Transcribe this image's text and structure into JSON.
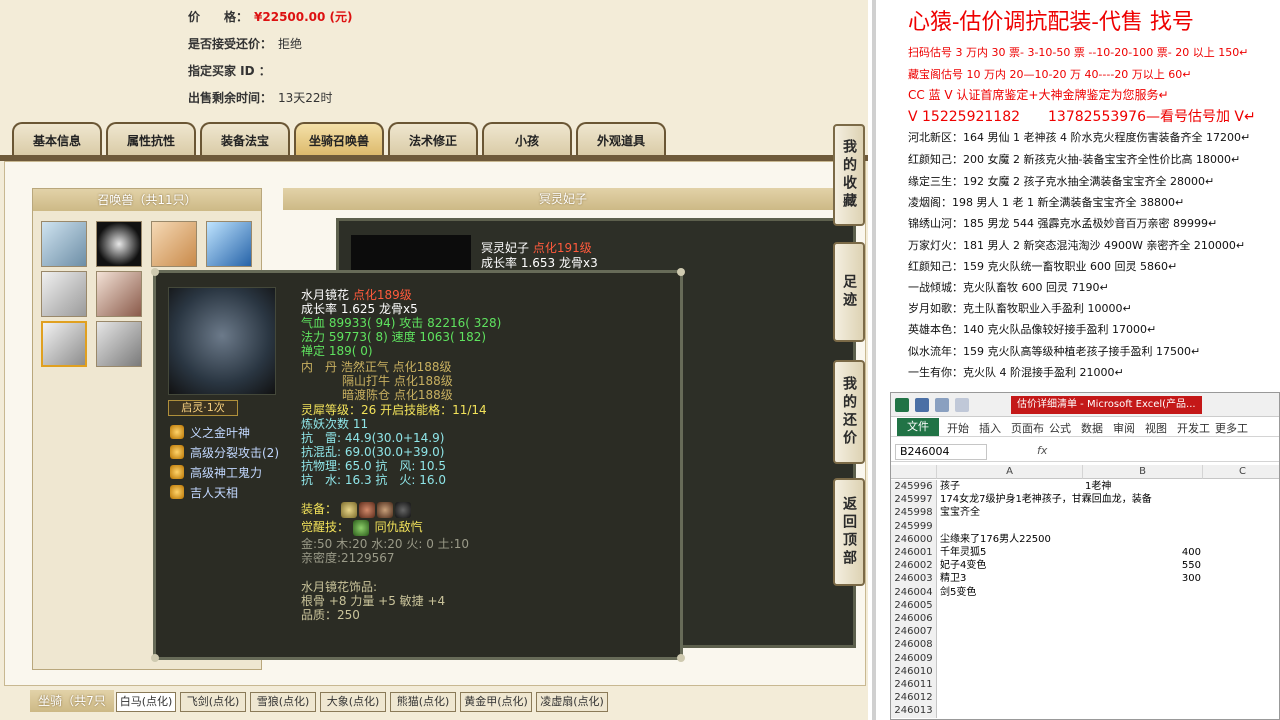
{
  "listing": {
    "price_label": "价　　格：",
    "price_value": "¥22500.00 (元)",
    "counter_offer_label": "是否接受还价：",
    "counter_offer_value": "拒绝",
    "buyer_label": "指定买家 ID ：",
    "buyer_value": "",
    "time_left_label": "出售剩余时间：",
    "time_left_value": "13天22时"
  },
  "tabs": [
    "基本信息",
    "属性抗性",
    "装备法宝",
    "坐骑召唤兽",
    "法术修正",
    "小孩",
    "外观道具"
  ],
  "side_buttons": [
    "我的收藏",
    "足迹",
    "我的还价",
    "返回顶部"
  ],
  "pet_panel": {
    "title": "召唤兽（共11只）"
  },
  "detail_title": "冥灵妃子",
  "bg_pet": {
    "name": "冥灵妃子",
    "level": "点化191级",
    "growth": "成长率 1.653 龙骨x3"
  },
  "tooltip": {
    "name": "水月镜花",
    "level": "点化189级",
    "growth": "成长率 1.625 龙骨x5",
    "hp": "气血 89933( 94) 攻击 82216( 328)",
    "mp": "法力 59773( 8) 速度 1063( 182)",
    "zen": "禅定 189( 0)",
    "neidan1": "内　丹 浩然正气 点化188级",
    "neidan2": "隔山打牛 点化188级",
    "neidan3": "暗渡陈仓 点化188级",
    "soul": "灵犀等级：26 开启技能格：11/14",
    "refine": "炼妖次数 11",
    "res1": "抗　雷: 44.9(30.0+14.9)",
    "res2": "抗混乱: 69.0(30.0+39.0)",
    "res3": "抗物理: 65.0 抗　风: 10.5",
    "res4": "抗　水: 16.3 抗　火: 16.0",
    "equip_label": "装备：",
    "awaken_label": "觉醒技：",
    "awaken_value": "同仇敌忾",
    "elements": "金:50 木:20 水:20 火: 0 土:10",
    "intimacy": "亲密度:2129567",
    "ornament_title": "水月镜花饰品:",
    "ornament_stats": "根骨 +8 力量 +5 敏捷 +4",
    "ornament_quality": "品质：250",
    "spirit_badge": "启灵·1次",
    "skills": [
      "义之金叶神",
      "高级分裂攻击(2)",
      "高级神工鬼力",
      "吉人天相"
    ]
  },
  "bottom": {
    "title": "坐骑（共7只",
    "tabs": [
      "白马(点化)",
      "飞剑(点化)",
      "雪狼(点化)",
      "大象(点化)",
      "熊猫(点化)",
      "黄金甲(点化)",
      "凌虚扇(点化)"
    ]
  },
  "notes": {
    "title": "心猿-估价调抗配装-代售 找号",
    "red_lines": [
      "扫码估号 3 万内 30 票- 3-10-50 票 --10-20-100 票- 20 以上 150↵",
      "藏宝阁估号 10 万内 20—10-20 万 40----20 万以上 60↵",
      "CC 蓝 V 认证首席鉴定+大神金牌鉴定为您服务↵",
      "V 15225921182　　13782553976—看号估号加 V↵"
    ],
    "lines": [
      "河北新区：164 男仙 1 老神孩 4 阶水克火程度伤害装备齐全 17200↵",
      "红颜知己：200 女魔 2 新孩克火抽-装备宝宝齐全性价比高 18000↵",
      "缘定三生：192 女魔 2 孩子克水抽全满装备宝宝齐全 28000↵",
      "凌烟阁：198 男人 1 老 1 新全满装备宝宝齐全 38800↵",
      "锦绣山河：185 男龙 544 强霹克水孟极妙音百万亲密 89999↵",
      "万家灯火：181 男人 2 新突态混沌淘沙 4900W 亲密齐全 210000↵",
      "红颜知己：159 克火队统一畜牧职业 600 回灵 5860↵",
      "一战倾城：克火队畜牧 600 回灵 7190↵",
      "岁月如歌：克土队畜牧职业入手盈利 10000↵",
      "英雄本色：140 克火队品像较好接手盈利 17000↵",
      "似水流年：159 克火队高等级种植老孩子接手盈利 17500↵",
      "一生有你：克火队 4 阶混接手盈利 21000↵"
    ]
  },
  "excel": {
    "title": "估价详细清单 - Microsoft Excel(产品...",
    "menu": [
      "文件",
      "开始",
      "插入",
      "页面布",
      "公式",
      "数据",
      "审阅",
      "视图",
      "开发工",
      "更多工"
    ],
    "namebox": "B246004",
    "fx": "fx",
    "col_headers": [
      "A",
      "B",
      "C"
    ],
    "rows": [
      {
        "n": "245996",
        "a": "孩子",
        "b": "1老神"
      },
      {
        "n": "245997",
        "a": "174女龙7级护身1老神孩子，甘霖回血龙，装备",
        "b": ""
      },
      {
        "n": "245998",
        "a": "宝宝齐全",
        "b": ""
      },
      {
        "n": "245999",
        "a": "",
        "b": ""
      },
      {
        "n": "246000",
        "a": "尘缘来了176男人22500",
        "b": ""
      },
      {
        "n": "246001",
        "a": "千年灵狐5",
        "b": "400"
      },
      {
        "n": "246002",
        "a": "妃子4变色",
        "b": "550"
      },
      {
        "n": "246003",
        "a": "精卫3",
        "b": "300"
      },
      {
        "n": "246004",
        "a": "剑5变色",
        "b": ""
      },
      {
        "n": "246005",
        "a": "",
        "b": ""
      },
      {
        "n": "246006",
        "a": "",
        "b": ""
      },
      {
        "n": "246007",
        "a": "",
        "b": ""
      },
      {
        "n": "246008",
        "a": "",
        "b": ""
      },
      {
        "n": "246009",
        "a": "",
        "b": ""
      },
      {
        "n": "246010",
        "a": "",
        "b": ""
      },
      {
        "n": "246011",
        "a": "",
        "b": ""
      },
      {
        "n": "246012",
        "a": "",
        "b": ""
      },
      {
        "n": "246013",
        "a": "",
        "b": ""
      }
    ]
  },
  "colors": {
    "price_red": "#dd1111",
    "note_red": "#ee0000",
    "excel_green": "#217346",
    "excel_title_red": "#c41818"
  }
}
